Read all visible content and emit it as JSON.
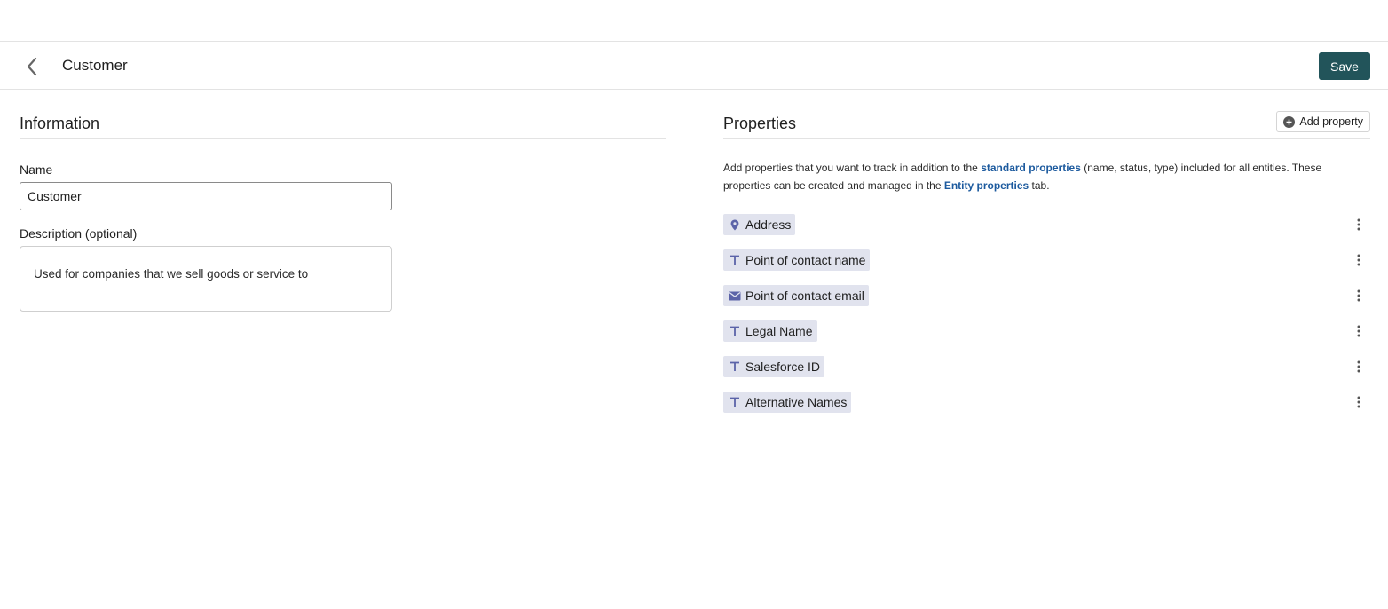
{
  "header": {
    "title": "Customer",
    "save_label": "Save"
  },
  "information": {
    "heading": "Information",
    "name_label": "Name",
    "name_value": "Customer",
    "description_label": "Description (optional)",
    "description_value": "Used for companies that we sell goods or service to"
  },
  "properties": {
    "heading": "Properties",
    "add_label": "Add property",
    "helper_1": "Add properties that you want to track in addition to the ",
    "helper_link_1": "standard properties",
    "helper_2": " (name, status, type) included for all entities. These properties can be created and managed in the ",
    "helper_link_2": "Entity properties",
    "helper_3": " tab.",
    "items": [
      {
        "label": "Address",
        "icon": "location-pin-icon"
      },
      {
        "label": "Point of contact name",
        "icon": "text-type-icon"
      },
      {
        "label": "Point of contact email",
        "icon": "email-icon"
      },
      {
        "label": "Legal Name",
        "icon": "text-type-icon"
      },
      {
        "label": "Salesforce ID",
        "icon": "text-type-icon"
      },
      {
        "label": "Alternative Names",
        "icon": "text-type-icon"
      }
    ]
  },
  "colors": {
    "primary": "#22545a",
    "link": "#1c5a9e",
    "chip_bg": "#e1e3ee",
    "chip_icon": "#5b63a8"
  }
}
